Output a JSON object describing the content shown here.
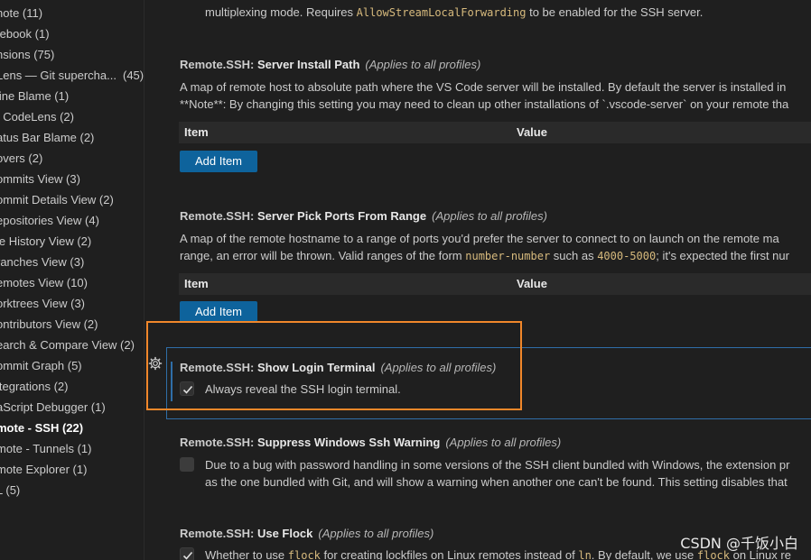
{
  "toc": {
    "items": [
      {
        "label": "note (11)"
      },
      {
        "label": "tebook (1)"
      },
      {
        "label": "nsions (75)"
      },
      {
        "label": "Lens — Git supercha...",
        "count": "(45)"
      },
      {
        "label": "line Blame (1)"
      },
      {
        "label": "t CodeLens (2)"
      },
      {
        "label": "atus Bar Blame (2)"
      },
      {
        "label": "overs (2)"
      },
      {
        "label": "ommits View (3)"
      },
      {
        "label": "ommit Details View (2)"
      },
      {
        "label": "epositories View (4)"
      },
      {
        "label": "le History View (2)"
      },
      {
        "label": "ranches View (3)"
      },
      {
        "label": "emotes View (10)"
      },
      {
        "label": "orktrees View (3)"
      },
      {
        "label": "ontributors View (2)"
      },
      {
        "label": "earch & Compare View (2)"
      },
      {
        "label": "ommit Graph (5)"
      },
      {
        "label": "itegrations (2)"
      },
      {
        "label": "aScript Debugger (1)"
      },
      {
        "label": "mote - SSH (22)",
        "active": true
      },
      {
        "label": "mote - Tunnels (1)"
      },
      {
        "label": "mote Explorer (1)"
      },
      {
        "label": "L (5)"
      }
    ]
  },
  "settings": {
    "top_desc": {
      "before": "multiplexing mode. Requires ",
      "code": "AllowStreamLocalForwarding",
      "after": " to be enabled for the SSH server."
    },
    "server_install_path": {
      "category": "Remote.SSH: ",
      "name": "Server Install Path",
      "scope": "(Applies to all profiles)",
      "desc1": "A map of remote host to absolute path where the VS Code server will be installed. By default the server is installed in",
      "desc2": "**Note**: By changing this setting you may need to clean up other installations of `.vscode-server` on your remote tha",
      "col_item": "Item",
      "col_value": "Value",
      "add_label": "Add Item"
    },
    "pick_ports": {
      "category": "Remote.SSH: ",
      "name": "Server Pick Ports From Range",
      "scope": "(Applies to all profiles)",
      "desc1": "A map of the remote hostname to a range of ports you'd prefer the server to connect to on launch on the remote ma",
      "desc2_a": "range, an error will be thrown. Valid ranges of the form ",
      "desc2_code1": "number-number",
      "desc2_b": " such as ",
      "desc2_code2": "4000-5000",
      "desc2_c": "; it's expected the first nur",
      "col_item": "Item",
      "col_value": "Value",
      "add_label": "Add Item"
    },
    "show_login_terminal": {
      "category": "Remote.SSH: ",
      "name": "Show Login Terminal",
      "scope": "(Applies to all profiles)",
      "checkbox_label": "Always reveal the SSH login terminal.",
      "checked": true
    },
    "suppress_warning": {
      "category": "Remote.SSH: ",
      "name": "Suppress Windows Ssh Warning",
      "scope": "(Applies to all profiles)",
      "desc1": "Due to a bug with password handling in some versions of the SSH client bundled with Windows, the extension pr",
      "desc2": "as the one bundled with Git, and will show a warning when another one can't be found. This setting disables that",
      "checked": false
    },
    "use_flock": {
      "category": "Remote.SSH: ",
      "name": "Use Flock",
      "scope": "(Applies to all profiles)",
      "desc_a": "Whether to use ",
      "desc_code1": "flock",
      "desc_b": " for creating lockfiles on Linux remotes instead of ",
      "desc_code2": "ln",
      "desc_c": ". By default, we use ",
      "desc_code3": "flock",
      "desc_d": " on Linux re",
      "checked": true
    }
  },
  "watermark": "CSDN @千饭小白",
  "colors": {
    "accent": "#0e639c",
    "focus_border": "#2f6ea8",
    "highlight": "#f0872a",
    "code": "#d7ba7d"
  }
}
